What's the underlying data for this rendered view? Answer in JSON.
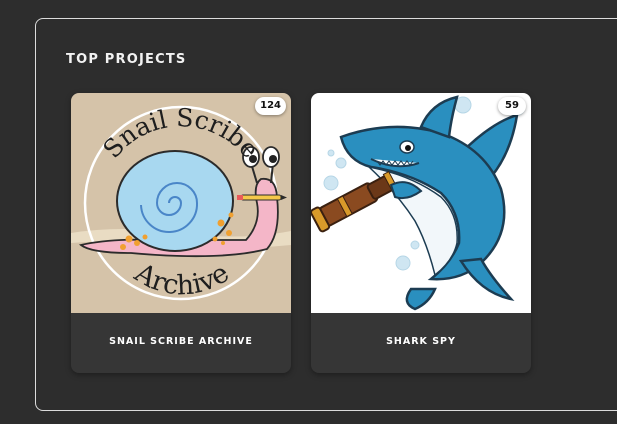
{
  "section": {
    "title": "TOP PROJECTS"
  },
  "projects": [
    {
      "name": "SNAIL SCRIBE ARCHIVE",
      "count": "124",
      "artwork_text_top": "Snail Scribe",
      "artwork_text_bottom": "Archive"
    },
    {
      "name": "SHARK SPY",
      "count": "59"
    }
  ],
  "colors": {
    "background": "#2d2d2d",
    "card": "#363636",
    "snail_bg": "#d5c3a9",
    "snail_shell": "#a8d8f0",
    "snail_body": "#f4b6c8",
    "shark_blue": "#2a8fbf"
  }
}
